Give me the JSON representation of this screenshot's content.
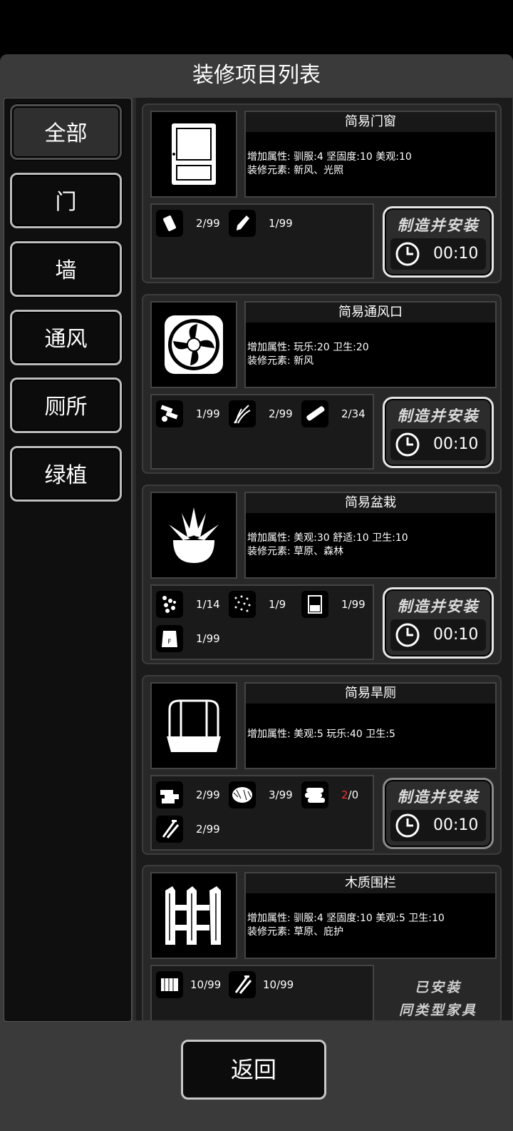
{
  "header": {
    "title": "装修项目列表"
  },
  "sidebar": {
    "items": [
      {
        "label": "全部",
        "active": true
      },
      {
        "label": "门"
      },
      {
        "label": "墙"
      },
      {
        "label": "通风"
      },
      {
        "label": "厕所"
      },
      {
        "label": "绿植"
      }
    ]
  },
  "items": [
    {
      "name": "简易门窗",
      "line1": "增加属性: 驯服:4 坚固度:10 美观:10",
      "line2": "装修元素: 新风、光照",
      "materials": [
        {
          "icon": "fabric-roll-icon",
          "count": "2/99"
        },
        {
          "icon": "glue-bottle-icon",
          "count": "1/99"
        }
      ],
      "craft_label": "制造并安装",
      "time": "00:10"
    },
    {
      "name": "简易通风口",
      "line1": "增加属性: 玩乐:20 卫生:20",
      "line2": "装修元素: 新风",
      "materials": [
        {
          "icon": "parts-icon",
          "count": "1/99"
        },
        {
          "icon": "grass-icon",
          "count": "2/99"
        },
        {
          "icon": "plank-icon",
          "count": "2/34"
        }
      ],
      "craft_label": "制造并安装",
      "time": "00:10"
    },
    {
      "name": "简易盆栽",
      "line1": "增加属性: 美观:30 舒适:10 卫生:10",
      "line2": "装修元素: 草原、森林",
      "materials": [
        {
          "icon": "seeds-icon",
          "count": "1/14"
        },
        {
          "icon": "sprinkle-icon",
          "count": "1/9"
        },
        {
          "icon": "jar-icon",
          "count": "1/99"
        },
        {
          "icon": "fertilizer-bag-icon",
          "count": "1/99"
        }
      ],
      "craft_label": "制造并安装",
      "time": "00:10"
    },
    {
      "name": "简易旱厕",
      "line1": "增加属性: 美观:5 玩乐:40 卫生:5",
      "line2": "",
      "materials": [
        {
          "icon": "boards-icon",
          "count": "2/99"
        },
        {
          "icon": "hay-icon",
          "count": "3/99"
        },
        {
          "icon": "logs-icon",
          "count_have": "2",
          "count_total": "/0"
        },
        {
          "icon": "nails-icon",
          "count": "2/99"
        }
      ],
      "craft_label": "制造并安装",
      "time": "00:10"
    },
    {
      "name": "木质围栏",
      "line1": "增加属性: 驯服:4 坚固度:10 美观:5 卫生:10",
      "line2": "装修元素: 草原、庇护",
      "materials": [
        {
          "icon": "wood-bundle-icon",
          "count": "10/99"
        },
        {
          "icon": "nails-icon",
          "count": "10/99"
        }
      ],
      "installed_line1": "已安装",
      "installed_line2": "同类型家具"
    }
  ],
  "footer": {
    "back_label": "返回"
  },
  "colors": {
    "background": "#000000",
    "panel": "#3a3a3a",
    "card": "#282828",
    "warning": "#e33333"
  }
}
